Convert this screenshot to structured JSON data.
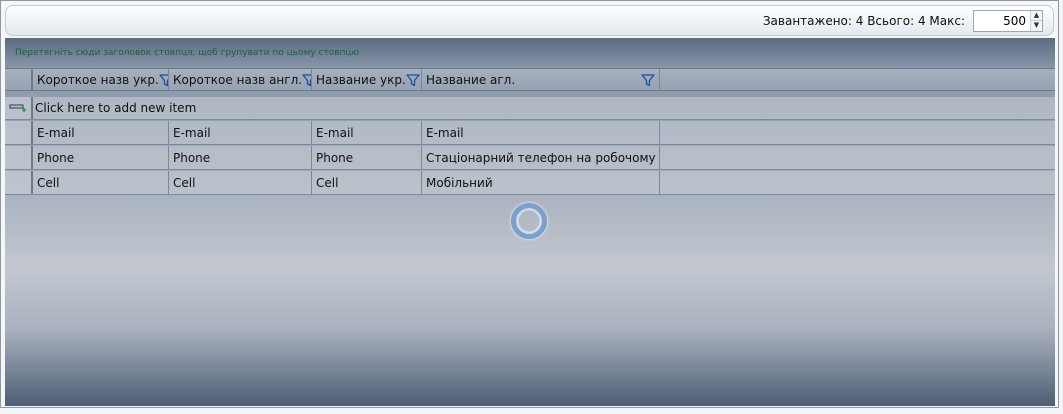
{
  "toolbar": {
    "stats": "Завантажено: 4 Всього: 4 Макс:",
    "max_value": "500",
    "spin_up": "▲",
    "spin_down": "▼"
  },
  "grid": {
    "group_panel_text": "Перетягніть сюди заголовок стовпця, щоб групувати по цьому стовпцю",
    "columns": [
      {
        "label": "Короткое назв укр."
      },
      {
        "label": "Короткое назв англ."
      },
      {
        "label": "Название укр."
      },
      {
        "label": "Название агл."
      }
    ],
    "new_item_text": "Click here to add new item",
    "rows": [
      [
        "E-mail",
        "E-mail",
        "E-mail",
        "E-mail"
      ],
      [
        "Phone",
        "Phone",
        "Phone",
        "Стаціонарний телефон на робочому місці"
      ],
      [
        "Cell",
        "Cell",
        "Cell",
        "Мобільний"
      ]
    ],
    "icons": {
      "filter": "filter-icon",
      "add_row": "add-row-icon",
      "loading": "loading-spinner"
    },
    "colors": {
      "group_text": "#14663a",
      "filter_icon": "#1f4f9a"
    }
  }
}
